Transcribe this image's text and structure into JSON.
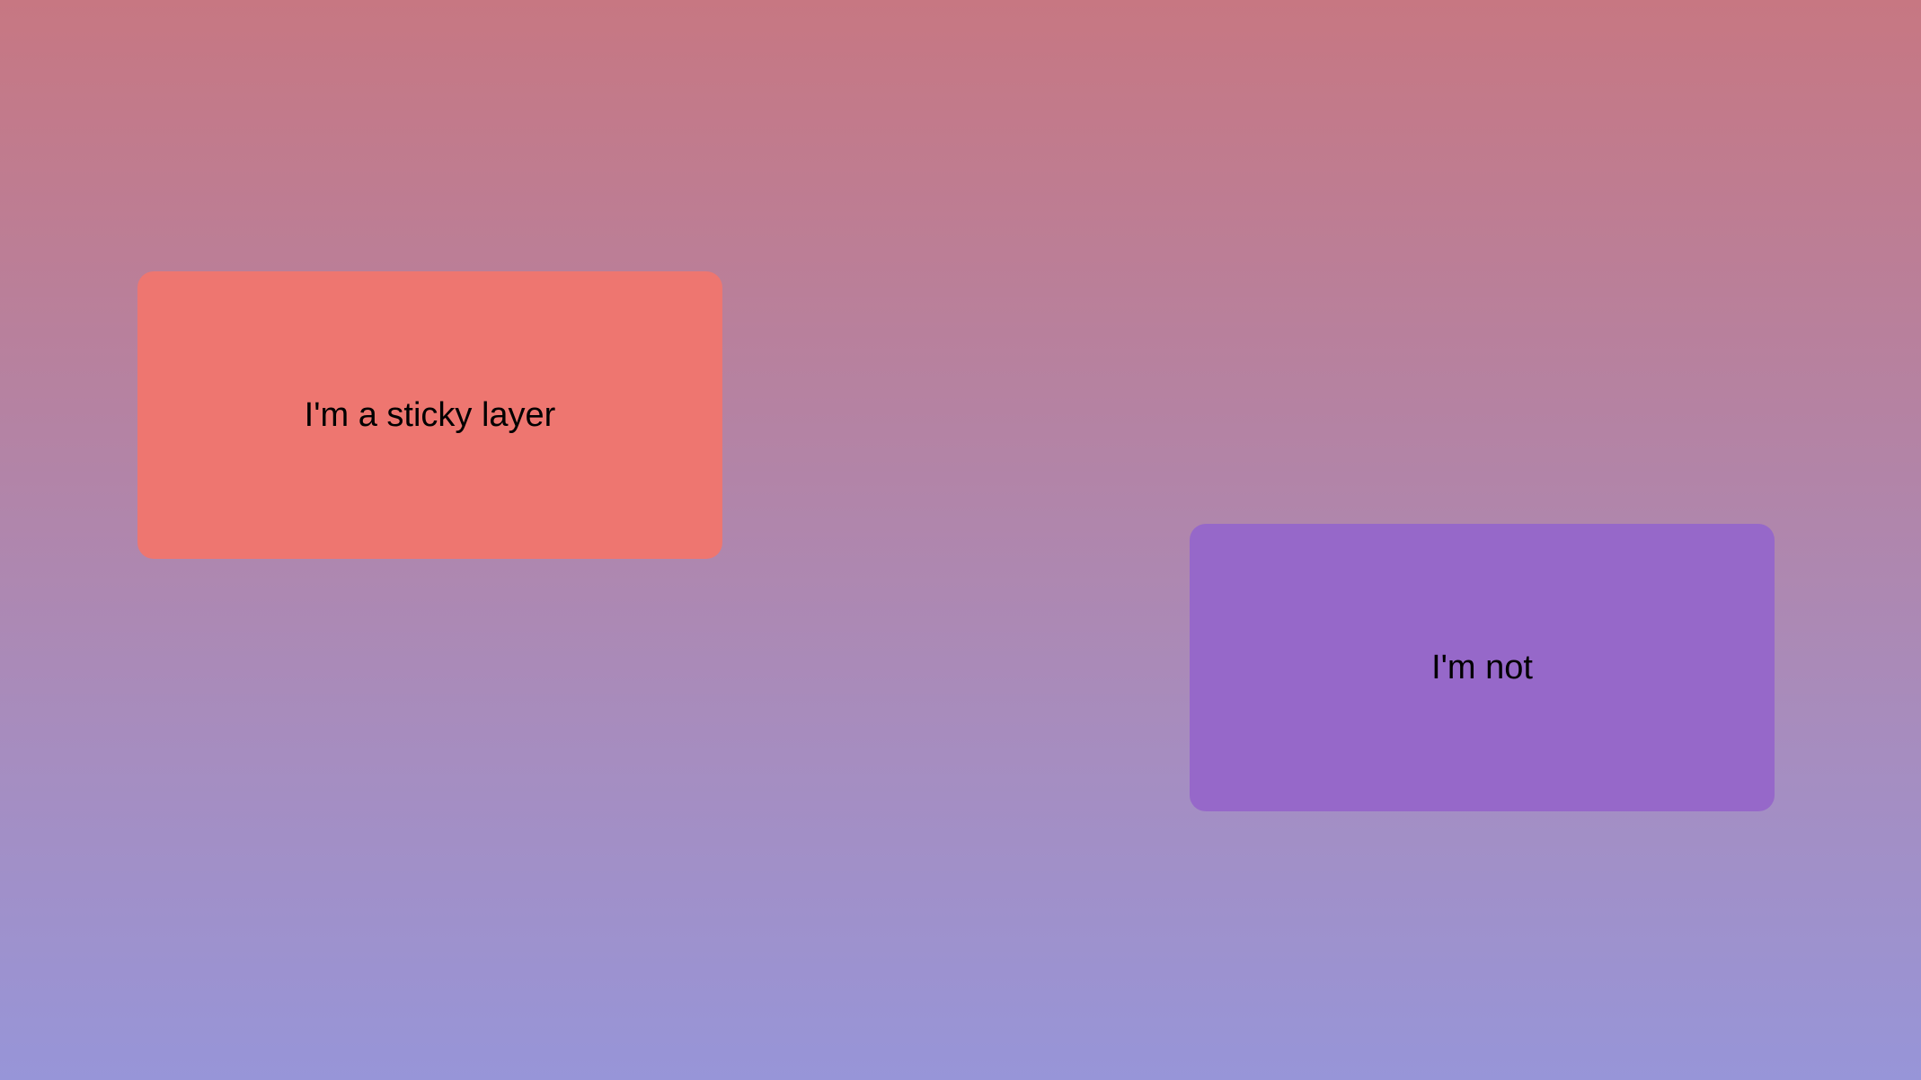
{
  "layers": {
    "sticky": {
      "label": "I'm a sticky layer",
      "color": "#ee7670"
    },
    "not_sticky": {
      "label": "I'm not",
      "color": "#9668c9"
    }
  },
  "background": {
    "gradient_top": "#c77782",
    "gradient_bottom": "#9795d8"
  }
}
